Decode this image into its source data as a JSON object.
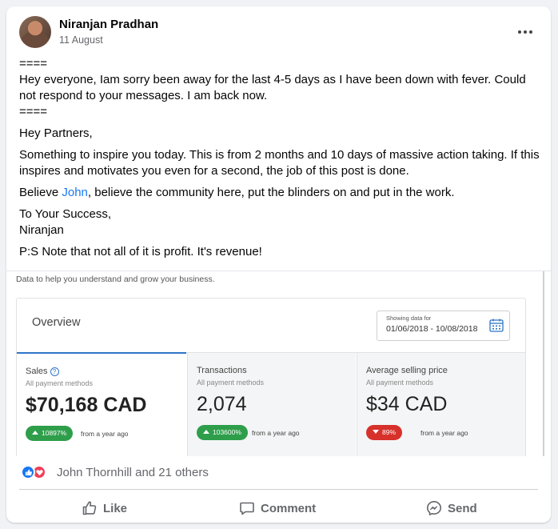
{
  "post": {
    "author": "Niranjan Pradhan",
    "date": "11 August",
    "more_label": "•••"
  },
  "body": {
    "separator_top": "====",
    "line1": "Hey everyone, Iam sorry been away for the last 4-5 days as I have been down with fever. Could not respond to your messages. I am back now.",
    "separator_bottom": "====",
    "greeting": "Hey Partners,",
    "para1": "Something to inspire you today. This is from 2 months and 10 days of massive action taking. If this inspires and motivates you even for a second, the job of this post is done.",
    "para2_before": "Believe ",
    "para2_link": "John",
    "para2_after": ", believe the community here, put the blinders on and put in the work.",
    "closing1": "To Your Success,",
    "closing2": "Niranjan",
    "ps": "P:S Note that not all of it is profit. It's revenue!"
  },
  "screenshot": {
    "subtitle": "Data to help you understand and grow your business.",
    "overview_title": "Overview",
    "range_label": "Showing data for",
    "range_value": "01/06/2018 - 10/08/2018",
    "metrics": [
      {
        "title": "Sales",
        "sub": "All payment methods",
        "value": "$70,168 CAD",
        "change": "10897%",
        "direction": "up",
        "from": "from a year ago"
      },
      {
        "title": "Transactions",
        "sub": "All payment methods",
        "value": "2,074",
        "change": "103600%",
        "direction": "up",
        "from": "from a year ago"
      },
      {
        "title": "Average selling price",
        "sub": "All payment methods",
        "value": "$34 CAD",
        "change": "89%",
        "direction": "down",
        "from": "from a year ago"
      }
    ],
    "colors": {
      "up": "#2e9e4b",
      "down": "#d7312b",
      "accent": "#2f75c7"
    }
  },
  "reactions": {
    "summary": "John Thornhill and 21 others",
    "icons": [
      "like-icon",
      "love-icon"
    ]
  },
  "actions": {
    "like": "Like",
    "comment": "Comment",
    "send": "Send"
  },
  "colors": {
    "link": "#1877f2",
    "secondary_text": "#65676b"
  }
}
